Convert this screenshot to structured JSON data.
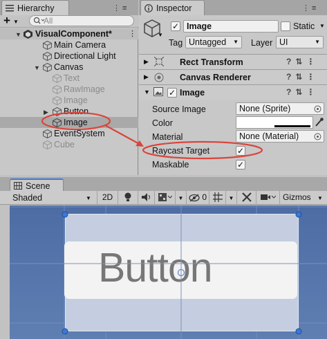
{
  "hierarchy": {
    "tab_label": "Hierarchy",
    "add_label": "+",
    "search_placeholder": "All",
    "scene_name": "VisualComponent*",
    "items": [
      {
        "label": "Main Camera"
      },
      {
        "label": "Directional Light"
      },
      {
        "label": "Canvas"
      },
      {
        "label": "Text"
      },
      {
        "label": "RawImage"
      },
      {
        "label": "Image"
      },
      {
        "label": "Button"
      },
      {
        "label": "Image"
      },
      {
        "label": "EventSystem"
      },
      {
        "label": "Cube"
      }
    ]
  },
  "inspector": {
    "tab_label": "Inspector",
    "object_name": "Image",
    "static_label": "Static",
    "tag_label": "Tag",
    "tag_value": "Untagged",
    "layer_label": "Layer",
    "layer_value": "UI",
    "components": [
      {
        "label": "Rect Transform"
      },
      {
        "label": "Canvas Renderer"
      },
      {
        "label": "Image"
      }
    ],
    "props": {
      "source_image_label": "Source Image",
      "source_image_value": "None (Sprite)",
      "color_label": "Color",
      "material_label": "Material",
      "material_value": "None (Material)",
      "raycast_label": "Raycast Target",
      "maskable_label": "Maskable"
    }
  },
  "scene": {
    "tab_label": "Scene",
    "shading_mode": "Shaded",
    "mode_2d": "2D",
    "hidden_count": "0",
    "gizmos_label": "Gizmos",
    "button_text": "Button"
  },
  "colors": {
    "annotation": "#d9453b",
    "scene_bg": "#5b7aac"
  }
}
